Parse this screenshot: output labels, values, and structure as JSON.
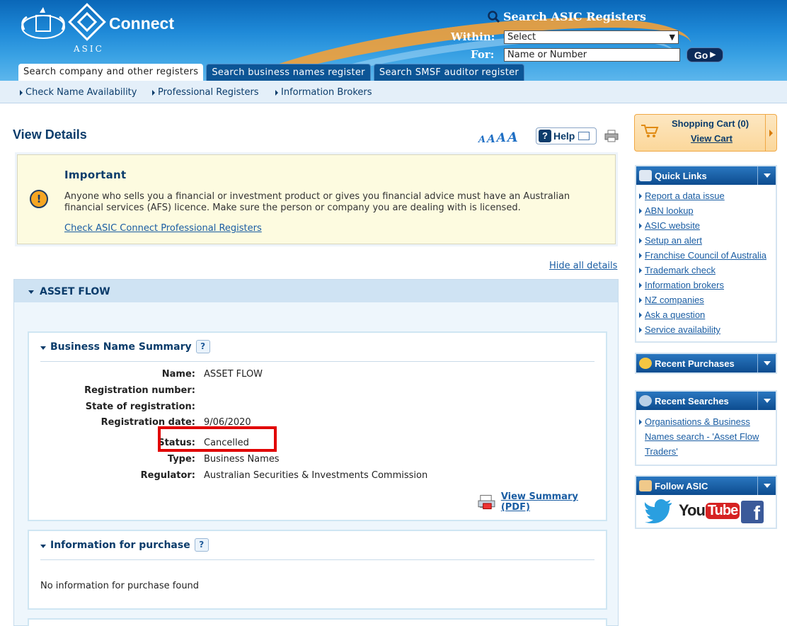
{
  "header": {
    "brand": "Connect",
    "org": "ASIC",
    "search_title": "Search ASIC Registers",
    "within_label": "Within:",
    "within_value": "Select",
    "for_label": "For:",
    "for_placeholder": "Name or Number",
    "go_label": "Go",
    "accent": "#0a67b8"
  },
  "tabs": [
    {
      "label": "Search company and other registers",
      "active": true
    },
    {
      "label": "Search business names register",
      "active": false
    },
    {
      "label": "Search SMSF auditor register",
      "active": false
    }
  ],
  "subnav": [
    {
      "label": "Check Name Availability"
    },
    {
      "label": "Professional Registers"
    },
    {
      "label": "Information Brokers"
    }
  ],
  "main": {
    "title": "View Details",
    "font_sizer": [
      "A",
      "A",
      "A",
      "A"
    ],
    "help_label": "Help",
    "important": {
      "title": "Important",
      "text": "Anyone who sells you a financial or investment product or gives you financial advice must have an Australian financial services (AFS) licence. Make sure the person or company you are dealing with is licensed.",
      "link": "Check ASIC Connect Professional Registers"
    },
    "hide_all": "Hide all details",
    "entity_name": "ASSET FLOW",
    "summary": {
      "title": "Business Name Summary",
      "rows": [
        {
          "key": "Name:",
          "value": "ASSET FLOW"
        },
        {
          "key": "Registration number:",
          "value": ""
        },
        {
          "key": "State of registration:",
          "value": ""
        },
        {
          "key": "Registration date:",
          "value": "9/06/2020"
        },
        {
          "key": "Status:",
          "value": "Cancelled"
        },
        {
          "key": "Type:",
          "value": "Business Names"
        },
        {
          "key": "Regulator:",
          "value": "Australian Securities & Investments Commission"
        }
      ],
      "pdf_link": "View Summary (PDF)"
    },
    "purchase": {
      "title": "Information for purchase",
      "empty_text": "No information for purchase found"
    }
  },
  "sidebar": {
    "cart_title": "Shopping Cart (0)",
    "cart_link": "View Cart",
    "quick_links_title": "Quick Links",
    "quick_links": [
      "Report a data issue",
      "ABN lookup",
      "ASIC website",
      "Setup an alert",
      "Franchise Council of Australia",
      "Trademark check",
      "Information brokers",
      "NZ companies",
      "Ask a question",
      "Service availability"
    ],
    "recent_purchases_title": "Recent Purchases",
    "recent_searches_title": "Recent Searches",
    "recent_search_item": "Organisations & Business Names search - 'Asset Flow Traders'",
    "follow_title": "Follow ASIC",
    "social": {
      "youtube_you": "You",
      "youtube_tube": "Tube",
      "facebook": "f"
    }
  }
}
